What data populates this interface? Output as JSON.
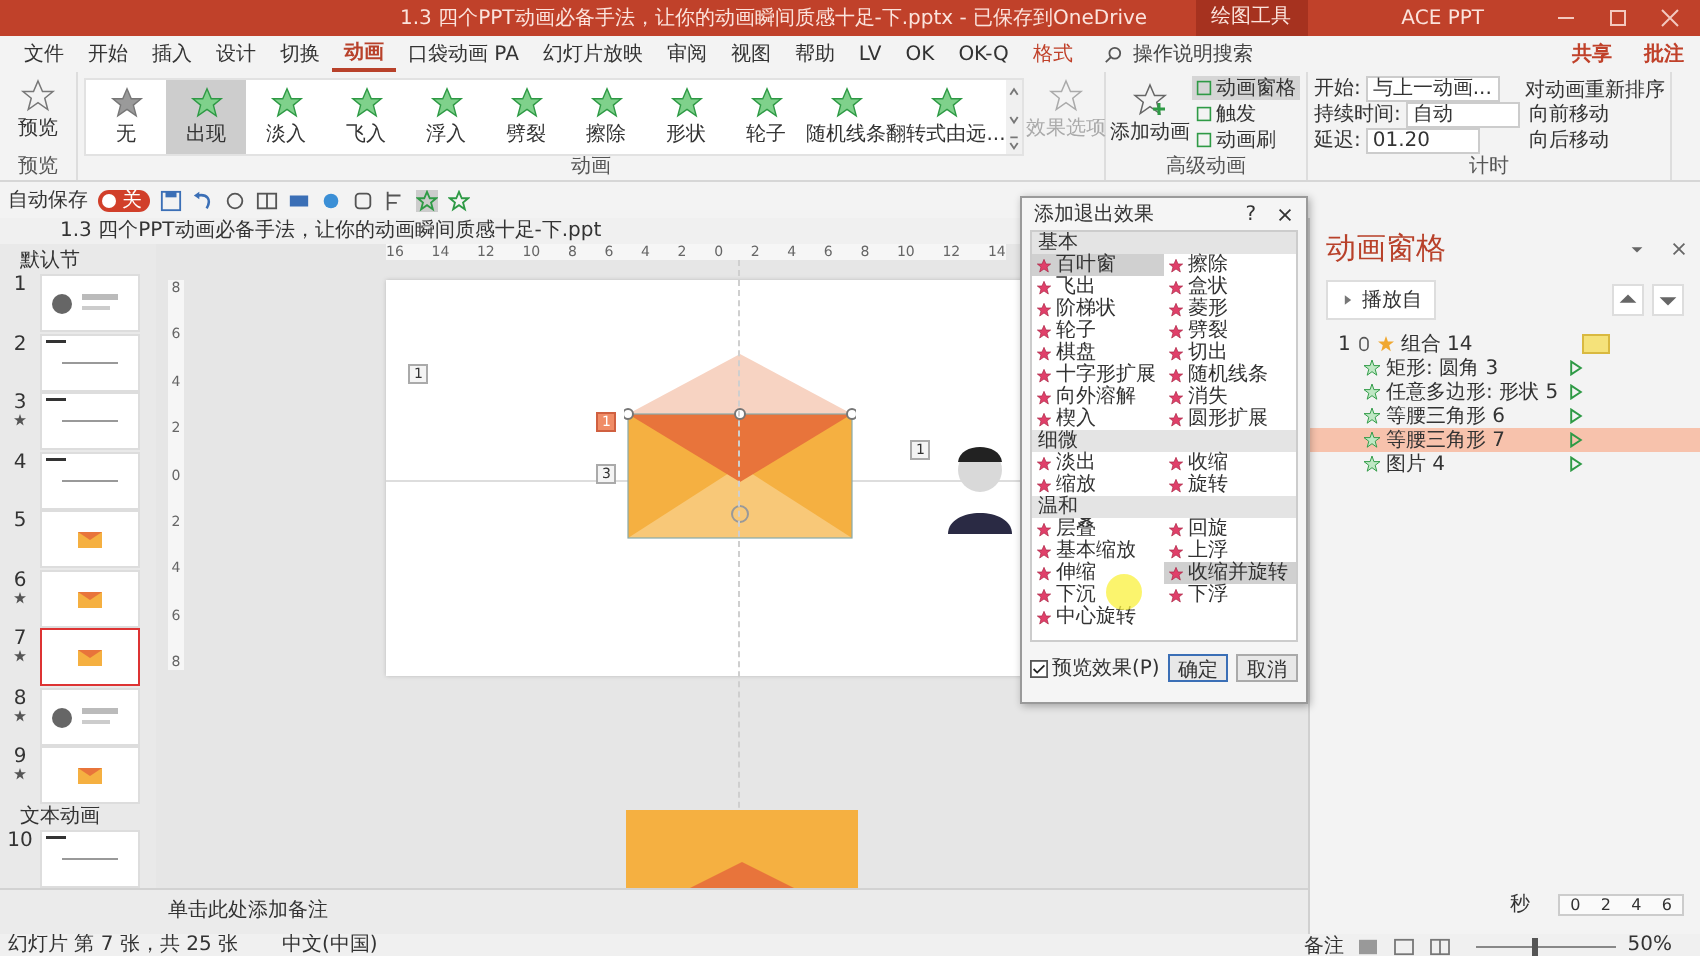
{
  "title_bar": {
    "title": "1.3 四个PPT动画必备手法，让你的动画瞬间质感十足-下.pptx  -  已保存到OneDrive",
    "context_tab": "绘图工具",
    "user": "ACE PPT"
  },
  "menu_tabs": [
    {
      "label": "文件",
      "selected": false,
      "kind": "normal"
    },
    {
      "label": "开始",
      "selected": false,
      "kind": "normal"
    },
    {
      "label": "插入",
      "selected": false,
      "kind": "normal"
    },
    {
      "label": "设计",
      "selected": false,
      "kind": "normal"
    },
    {
      "label": "切换",
      "selected": false,
      "kind": "normal"
    },
    {
      "label": "动画",
      "selected": true,
      "kind": "normal"
    },
    {
      "label": "口袋动画 PA",
      "selected": false,
      "kind": "normal"
    },
    {
      "label": "幻灯片放映",
      "selected": false,
      "kind": "normal"
    },
    {
      "label": "审阅",
      "selected": false,
      "kind": "normal"
    },
    {
      "label": "视图",
      "selected": false,
      "kind": "normal"
    },
    {
      "label": "帮助",
      "selected": false,
      "kind": "normal"
    },
    {
      "label": "LV",
      "selected": false,
      "kind": "normal"
    },
    {
      "label": "OK",
      "selected": false,
      "kind": "normal"
    },
    {
      "label": "OK-Q",
      "selected": false,
      "kind": "normal"
    },
    {
      "label": "格式",
      "selected": false,
      "kind": "context"
    }
  ],
  "search": {
    "placeholder": "操作说明搜索"
  },
  "share_button": "共享",
  "comment_button": "批注",
  "ribbon": {
    "preview": "预览",
    "effects": [
      {
        "label": "无",
        "selected": false
      },
      {
        "label": "出现",
        "selected": true
      },
      {
        "label": "淡入",
        "selected": false
      },
      {
        "label": "飞入",
        "selected": false
      },
      {
        "label": "浮入",
        "selected": false
      },
      {
        "label": "劈裂",
        "selected": false
      },
      {
        "label": "擦除",
        "selected": false
      },
      {
        "label": "形状",
        "selected": false
      },
      {
        "label": "轮子",
        "selected": false
      },
      {
        "label": "随机线条",
        "selected": false
      },
      {
        "label": "翻转式由远...",
        "selected": false
      }
    ],
    "effect_options": {
      "label": "效果选项",
      "disabled": true
    },
    "add_animation": "添加动画",
    "advanced": [
      {
        "label": "动画窗格",
        "selected": true
      },
      {
        "label": "触发",
        "selected": false
      },
      {
        "label": "动画刷",
        "selected": false
      }
    ],
    "timing": {
      "start_label": "开始:",
      "start_value": "与上一动画...",
      "duration_label": "持续时间:",
      "duration_value": "自动",
      "delay_label": "延迟:",
      "delay_value": "01.20"
    },
    "reorder": {
      "title": "对动画重新排序",
      "forward": "向前移动",
      "backward": "向后移动"
    },
    "groups": [
      "预览",
      "动画",
      "高级动画",
      "计时"
    ]
  },
  "quick_access": {
    "autosave_label": "自动保存",
    "autosave_on": false,
    "autosave_state": "关"
  },
  "document_tab": "1.3 四个PPT动画必备手法，让你的动画瞬间质感十足-下.ppt",
  "slide_panel": {
    "sections": [
      {
        "name": "默认节",
        "slides": [
          {
            "number": "1",
            "kind": "person",
            "animated": false,
            "selected": false
          },
          {
            "number": "2",
            "kind": "lines",
            "animated": false,
            "selected": false
          },
          {
            "number": "3",
            "kind": "lines",
            "animated": true,
            "selected": false
          },
          {
            "number": "4",
            "kind": "lines",
            "animated": false,
            "selected": false
          },
          {
            "number": "5",
            "kind": "envelope",
            "animated": false,
            "selected": false
          },
          {
            "number": "6",
            "kind": "envelope",
            "animated": true,
            "selected": false
          },
          {
            "number": "7",
            "kind": "envelope",
            "animated": true,
            "selected": true
          },
          {
            "number": "8",
            "kind": "person",
            "animated": true,
            "selected": false
          },
          {
            "number": "9",
            "kind": "envelope",
            "animated": true,
            "selected": false
          }
        ]
      },
      {
        "name": "文本动画",
        "slides": [
          {
            "number": "10",
            "kind": "lines",
            "animated": false,
            "selected": false
          }
        ]
      }
    ]
  },
  "ruler": {
    "horizontal": [
      "16",
      "14",
      "12",
      "10",
      "8",
      "6",
      "4",
      "2",
      "0",
      "2",
      "4",
      "6",
      "8",
      "10",
      "12",
      "14"
    ],
    "vertical": [
      "8",
      "6",
      "4",
      "2",
      "0",
      "2",
      "4",
      "6",
      "8"
    ]
  },
  "slide": {
    "tags": [
      {
        "label": "1",
        "selected": false
      },
      {
        "label": "1",
        "selected": true
      },
      {
        "label": "3",
        "selected": false
      },
      {
        "label": "1",
        "selected": false
      }
    ]
  },
  "notes_placeholder": "单击此处添加备注",
  "dialog": {
    "title": "添加退出效果",
    "help": "?",
    "groups": [
      {
        "name": "基本",
        "effects": [
          {
            "label": "百叶窗",
            "selected": true
          },
          {
            "label": "擦除",
            "selected": false
          },
          {
            "label": "飞出",
            "selected": false
          },
          {
            "label": "盒状",
            "selected": false
          },
          {
            "label": "阶梯状",
            "selected": false
          },
          {
            "label": "菱形",
            "selected": false
          },
          {
            "label": "轮子",
            "selected": false
          },
          {
            "label": "劈裂",
            "selected": false
          },
          {
            "label": "棋盘",
            "selected": false
          },
          {
            "label": "切出",
            "selected": false
          },
          {
            "label": "十字形扩展",
            "selected": false
          },
          {
            "label": "随机线条",
            "selected": false
          },
          {
            "label": "向外溶解",
            "selected": false
          },
          {
            "label": "消失",
            "selected": false
          },
          {
            "label": "楔入",
            "selected": false
          },
          {
            "label": "圆形扩展",
            "selected": false
          }
        ]
      },
      {
        "name": "细微",
        "effects": [
          {
            "label": "淡出",
            "selected": false
          },
          {
            "label": "收缩",
            "selected": false
          },
          {
            "label": "缩放",
            "selected": false
          },
          {
            "label": "旋转",
            "selected": false
          }
        ]
      },
      {
        "name": "温和",
        "effects": [
          {
            "label": "层叠",
            "selected": false
          },
          {
            "label": "回旋",
            "selected": false
          },
          {
            "label": "基本缩放",
            "selected": false
          },
          {
            "label": "上浮",
            "selected": false
          },
          {
            "label": "伸缩",
            "selected": false
          },
          {
            "label": "收缩并旋转",
            "selected": true
          },
          {
            "label": "下沉",
            "selected": false
          },
          {
            "label": "下浮",
            "selected": false
          },
          {
            "label": "中心旋转",
            "selected": false
          }
        ]
      }
    ],
    "preview_label": "预览效果(P)",
    "preview_checked": true,
    "ok": "确定",
    "cancel": "取消"
  },
  "animation_pane": {
    "title": "动画窗格",
    "play_button": "播放自",
    "order": "1",
    "group_name": "组合 14",
    "items": [
      {
        "name": "矩形: 圆角 3",
        "selected": false
      },
      {
        "name": "任意多边形: 形状 5",
        "selected": false
      },
      {
        "name": "等腰三角形 6",
        "selected": false
      },
      {
        "name": "等腰三角形 7",
        "selected": true
      },
      {
        "name": "图片 4",
        "selected": false
      }
    ],
    "timeline_unit": "秒",
    "ticks": [
      "0",
      "2",
      "4",
      "6"
    ]
  },
  "status_bar": {
    "slide_info": "幻灯片 第 7 张，共 25 张",
    "language": "中文(中国)",
    "notes": "备注",
    "zoom": "50%",
    "level": 0.4
  }
}
